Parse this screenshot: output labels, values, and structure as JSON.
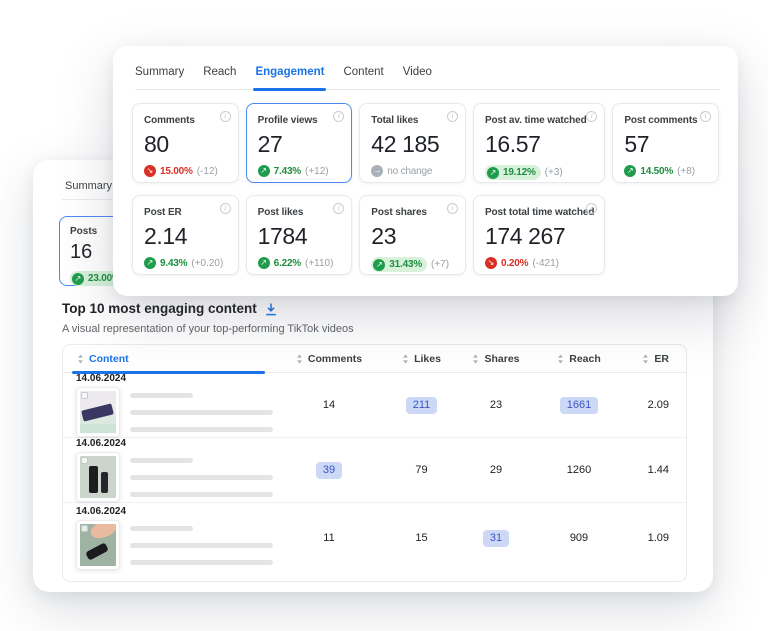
{
  "colors": {
    "accent_blue": "#1a73e8",
    "positive_green": "#1e8e3e",
    "negative_red": "#d93025",
    "green_highlight_bg": "#d7f1db",
    "blue_pill_bg": "#ccd8f6",
    "blue_pill_text": "#3c55c5"
  },
  "engagement_panel": {
    "tabs": [
      {
        "label": "Summary"
      },
      {
        "label": "Reach"
      },
      {
        "label": "Engagement",
        "active": true
      },
      {
        "label": "Content"
      },
      {
        "label": "Video"
      }
    ],
    "metric_cards": [
      {
        "label": "Comments",
        "value": "80",
        "direction": "down",
        "pct": "15.00%",
        "change": "(-12)"
      },
      {
        "label": "Profile views",
        "value": "27",
        "direction": "up",
        "pct": "7.43%",
        "change": "(+12)",
        "selected": true
      },
      {
        "label": "Total likes",
        "value": "42 185",
        "direction": "none",
        "pct": "no change",
        "change": ""
      },
      {
        "label": "Post av. time watched",
        "value": "16.57",
        "direction": "up",
        "pct": "19.12%",
        "change": "(+3)",
        "highlighted": true
      },
      {
        "label": "Post comments",
        "value": "57",
        "direction": "up",
        "pct": "14.50%",
        "change": "(+8)"
      },
      {
        "label": "Post ER",
        "value": "2.14",
        "direction": "up",
        "pct": "9.43%",
        "change": "(+0.20)"
      },
      {
        "label": "Post likes",
        "value": "1784",
        "direction": "up",
        "pct": "6.22%",
        "change": "(+110)"
      },
      {
        "label": "Post shares",
        "value": "23",
        "direction": "up",
        "pct": "31.43%",
        "change": "(+7)",
        "highlighted": true
      },
      {
        "label": "Post total time watched",
        "value": "174 267",
        "direction": "down",
        "pct": "0.20%",
        "change": "(-421)"
      }
    ]
  },
  "summary_panel": {
    "tab_label": "Summary",
    "card": {
      "label": "Posts",
      "value": "16",
      "direction": "up",
      "pct": "23.00%",
      "highlighted": true
    }
  },
  "content_section": {
    "title": "Top 10 most engaging content",
    "subtitle": "A visual representation of your top-performing TikTok videos",
    "table": {
      "columns": [
        "Content",
        "Comments",
        "Likes",
        "Shares",
        "Reach",
        "ER"
      ],
      "rows": [
        {
          "date": "14.06.2024",
          "comments": "14",
          "likes": "211",
          "shares": "23",
          "reach": "1661",
          "er": "2.09"
        },
        {
          "date": "14.06.2024",
          "comments": "39",
          "likes": "79",
          "shares": "29",
          "reach": "1260",
          "er": "1.44"
        },
        {
          "date": "14.06.2024",
          "comments": "11",
          "likes": "15",
          "shares": "31",
          "reach": "909",
          "er": "1.09"
        }
      ]
    }
  }
}
